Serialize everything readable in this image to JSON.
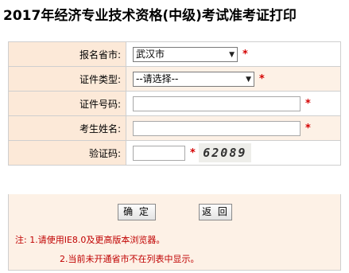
{
  "page": {
    "title": "2017年经济专业技术资格(中级)考试准考证打印"
  },
  "form": {
    "province": {
      "label": "报名省市:",
      "value": "武汉市",
      "required": "*",
      "icon": "chevron-down-icon"
    },
    "id_type": {
      "label": "证件类型:",
      "value": "--请选择--",
      "required": "*",
      "icon": "chevron-down-icon"
    },
    "id_number": {
      "label": "证件号码:",
      "value": "",
      "required": "*"
    },
    "name": {
      "label": "考生姓名:",
      "value": "",
      "required": "*"
    },
    "captcha": {
      "label": "验证码:",
      "value": "",
      "required": "*",
      "image_text": "62089"
    }
  },
  "buttons": {
    "confirm": "确 定",
    "back": "返 回"
  },
  "notes": {
    "line1": "注: 1.请使用IE8.0及更高版本浏览器。",
    "line2": "2.当前未开通省市不在列表中显示。"
  },
  "colors": {
    "label_bg": "#fce9d8",
    "row_alt_bg": "#fdf1e6",
    "required": "#d40000",
    "note_text": "#c00000"
  }
}
